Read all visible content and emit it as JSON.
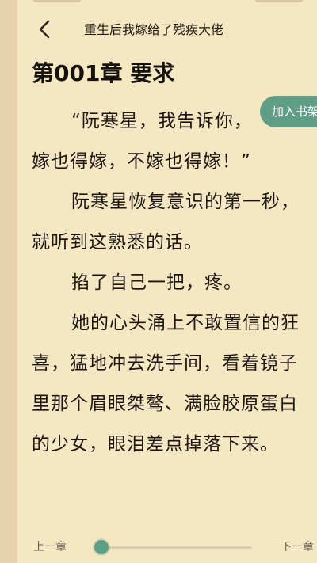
{
  "header": {
    "book_title": "重生后我嫁给了残疾大佬",
    "back_icon": "chevron-left-icon"
  },
  "chapter": {
    "title": "第001章 要求"
  },
  "content": {
    "lines": [
      {
        "text": "“阮寒星，我告诉你，",
        "indent": true
      },
      {
        "text": "嫁也得嫁，不嫁也得嫁！”",
        "indent": false
      },
      {
        "text": "阮寒星恢复意识的第一秒，",
        "indent": true
      },
      {
        "text": "就听到这熟悉的话。",
        "indent": false
      },
      {
        "text": "掐了自己一把，疼。",
        "indent": true
      },
      {
        "text": "她的心头涌上不敢置信的狂",
        "indent": true
      },
      {
        "text": "喜，猛地冲去洗手间，看着镜子",
        "indent": false
      },
      {
        "text": "里那个眉眼桀骜、满脸胶原蛋白",
        "indent": false
      },
      {
        "text": "的少女，眼泪差点掉落下来。",
        "indent": false
      }
    ]
  },
  "overlay": {
    "add_to_bookshelf_label": "加入书架"
  },
  "footer": {
    "prev_label": "上一章",
    "next_label": "下一章",
    "progress": 0.0
  },
  "colors": {
    "page_background": "#f6e7c3",
    "accent": "#5f9e86",
    "text": "#1c1712"
  }
}
